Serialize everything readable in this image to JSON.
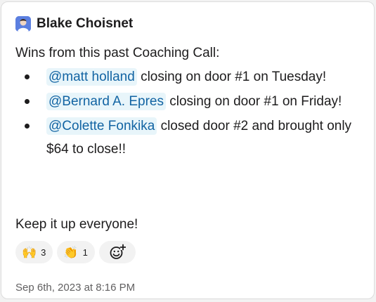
{
  "author": {
    "name": "Blake Choisnet"
  },
  "message": {
    "intro": "Wins from this past Coaching Call:",
    "items": [
      {
        "mention": "@matt holland",
        "text": " closing on door #1 on Tuesday!"
      },
      {
        "mention": "@Bernard A. Epres",
        "text": " closing on door #1 on Friday!"
      },
      {
        "mention": "@Colette Fonkika",
        "text": " closed door #2 and brought only $64 to close!!"
      }
    ],
    "closing": "Keep it up everyone!"
  },
  "reactions": [
    {
      "emoji": "🙌",
      "icon": "raised-hands-icon",
      "count": "3"
    },
    {
      "emoji": "👏",
      "icon": "clapping-hands-icon",
      "count": "1"
    }
  ],
  "add_reaction_icon": "add-emoji-icon",
  "timestamp": "Sep 6th, 2023 at 8:16 PM",
  "colors": {
    "mention_bg": "#e8f5fa",
    "mention_text": "#1264a3",
    "text": "#1d1c1d",
    "muted": "#616061"
  }
}
